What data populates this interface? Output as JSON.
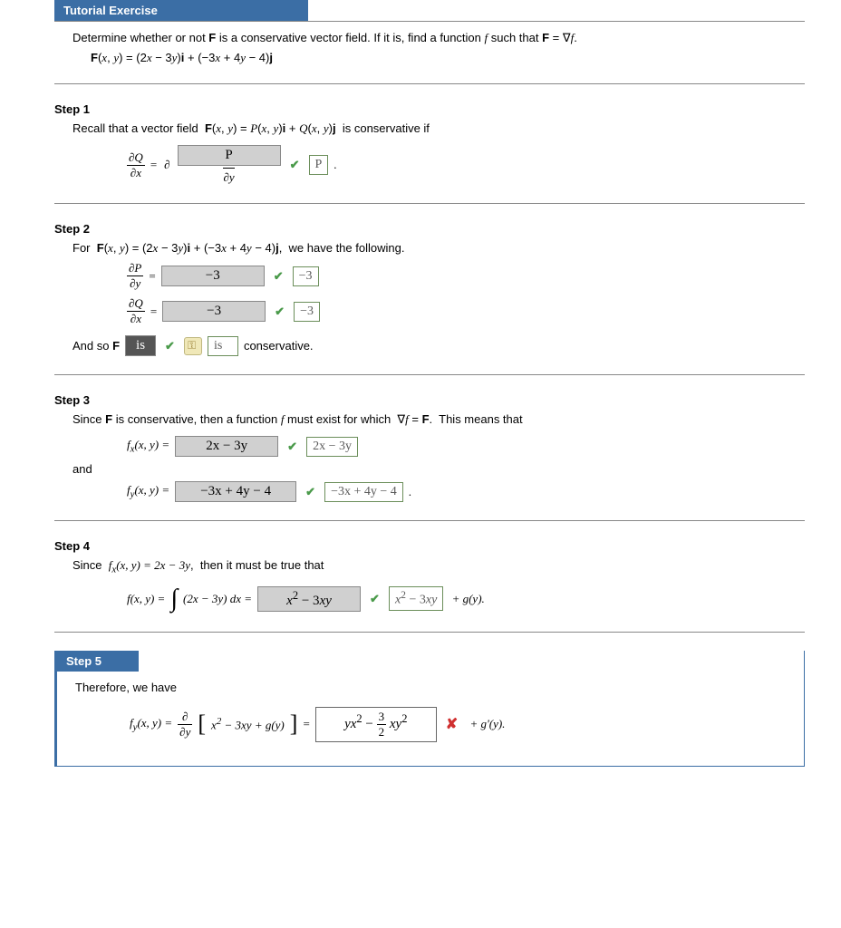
{
  "header": "Tutorial Exercise",
  "prompt_line1": "Determine whether or not F is a conservative vector field. If it is, find a function f such that F = ∇f.",
  "prompt_eq": "F(x, y) = (2x − 3y)i + (−3x + 4y − 4)j",
  "step1": {
    "title": "Step 1",
    "text": "Recall that a vector field  F(x, y) = P(x, y)i + Q(x, y)j  is conservative if",
    "lhs_num": "∂Q",
    "lhs_den": "∂x",
    "rhs_top": "∂",
    "rhs_bot": "∂y",
    "answer": "P",
    "correct": "P"
  },
  "step2": {
    "title": "Step 2",
    "text": "For  F(x, y) = (2x − 3y)i + (−3x + 4y − 4)j,  we have the following.",
    "dP_num": "∂P",
    "dP_den": "∂y",
    "dP_answer": "−3",
    "dP_correct": "−3",
    "dQ_num": "∂Q",
    "dQ_den": "∂x",
    "dQ_answer": "−3",
    "dQ_correct": "−3",
    "conclusion_pre": "And so F",
    "is_answer": "is",
    "is_correct": "is",
    "conclusion_post": " conservative."
  },
  "step3": {
    "title": "Step 3",
    "text": "Since F is conservative, then a function f must exist for which  ∇f = F.  This means that",
    "fx_label": "f_x(x, y) =",
    "fx_answer": "2x − 3y",
    "fx_correct": "2x − 3y",
    "and": "and",
    "fy_label": "f_y(x, y) =",
    "fy_answer": "−3x + 4y − 4",
    "fy_correct": "−3x + 4y − 4"
  },
  "step4": {
    "title": "Step 4",
    "text": "Since  f_x(x, y) = 2x − 3y,  then it must be true that",
    "lhs": "f(x, y) =",
    "integrand": "(2x − 3y) dx =",
    "answer": "x² − 3xy",
    "correct": "x² − 3xy",
    "tail": " + g(y)."
  },
  "step5": {
    "title": "Step 5",
    "text": "Therefore, we have",
    "lhs": "f_y(x, y) =",
    "deriv_num": "∂",
    "deriv_den": "∂y",
    "bracket_expr": "x² − 3xy + g(y)",
    "answer": "yx² − (3/2)xy²",
    "tail": " + g'(y)."
  }
}
